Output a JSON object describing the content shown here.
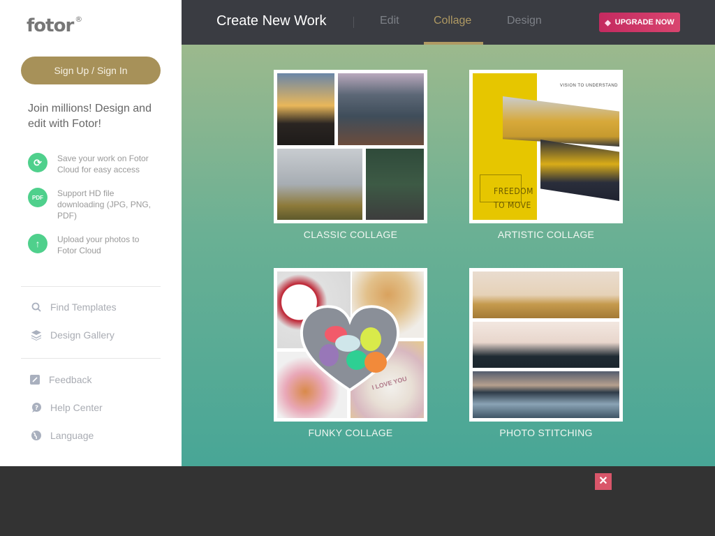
{
  "sidebar": {
    "logo": "fotor",
    "logo_mark": "®",
    "signup_label": "Sign Up / Sign In",
    "join_text": "Join millions! Design and edit with Fotor!",
    "features": [
      {
        "icon": "refresh-icon",
        "glyph": "⟳",
        "text": "Save your work on Fotor Cloud for easy access"
      },
      {
        "icon": "pdf-icon",
        "glyph": "PDF",
        "text": "Support HD file downloading (JPG, PNG, PDF)"
      },
      {
        "icon": "upload-icon",
        "glyph": "↑",
        "text": "Upload your photos to Fotor Cloud"
      }
    ],
    "nav": [
      {
        "icon": "search-icon",
        "label": "Find Templates"
      },
      {
        "icon": "layers-icon",
        "label": "Design Gallery"
      }
    ],
    "support": [
      {
        "icon": "edit-icon",
        "label": "Feedback"
      },
      {
        "icon": "help-icon",
        "label": "Help Center"
      },
      {
        "icon": "globe-icon",
        "label": "Language"
      }
    ]
  },
  "header": {
    "title": "Create New Work",
    "tabs": [
      {
        "label": "Edit",
        "active": false
      },
      {
        "label": "Collage",
        "active": true
      },
      {
        "label": "Design",
        "active": false
      }
    ],
    "upgrade_label": "UPGRADE NOW",
    "accent_color": "#b09a63"
  },
  "cards": [
    {
      "label": "CLASSIC COLLAGE"
    },
    {
      "label": "ARTISTIC COLLAGE",
      "poster_tagline": "VISION TO UNDERSTAND",
      "poster_title": "FREEDOM TO MOVE"
    },
    {
      "label": "FUNKY COLLAGE",
      "candy_text": "I LOVE YOU"
    },
    {
      "label": "PHOTO STITCHING"
    }
  ],
  "close_label": "✕"
}
